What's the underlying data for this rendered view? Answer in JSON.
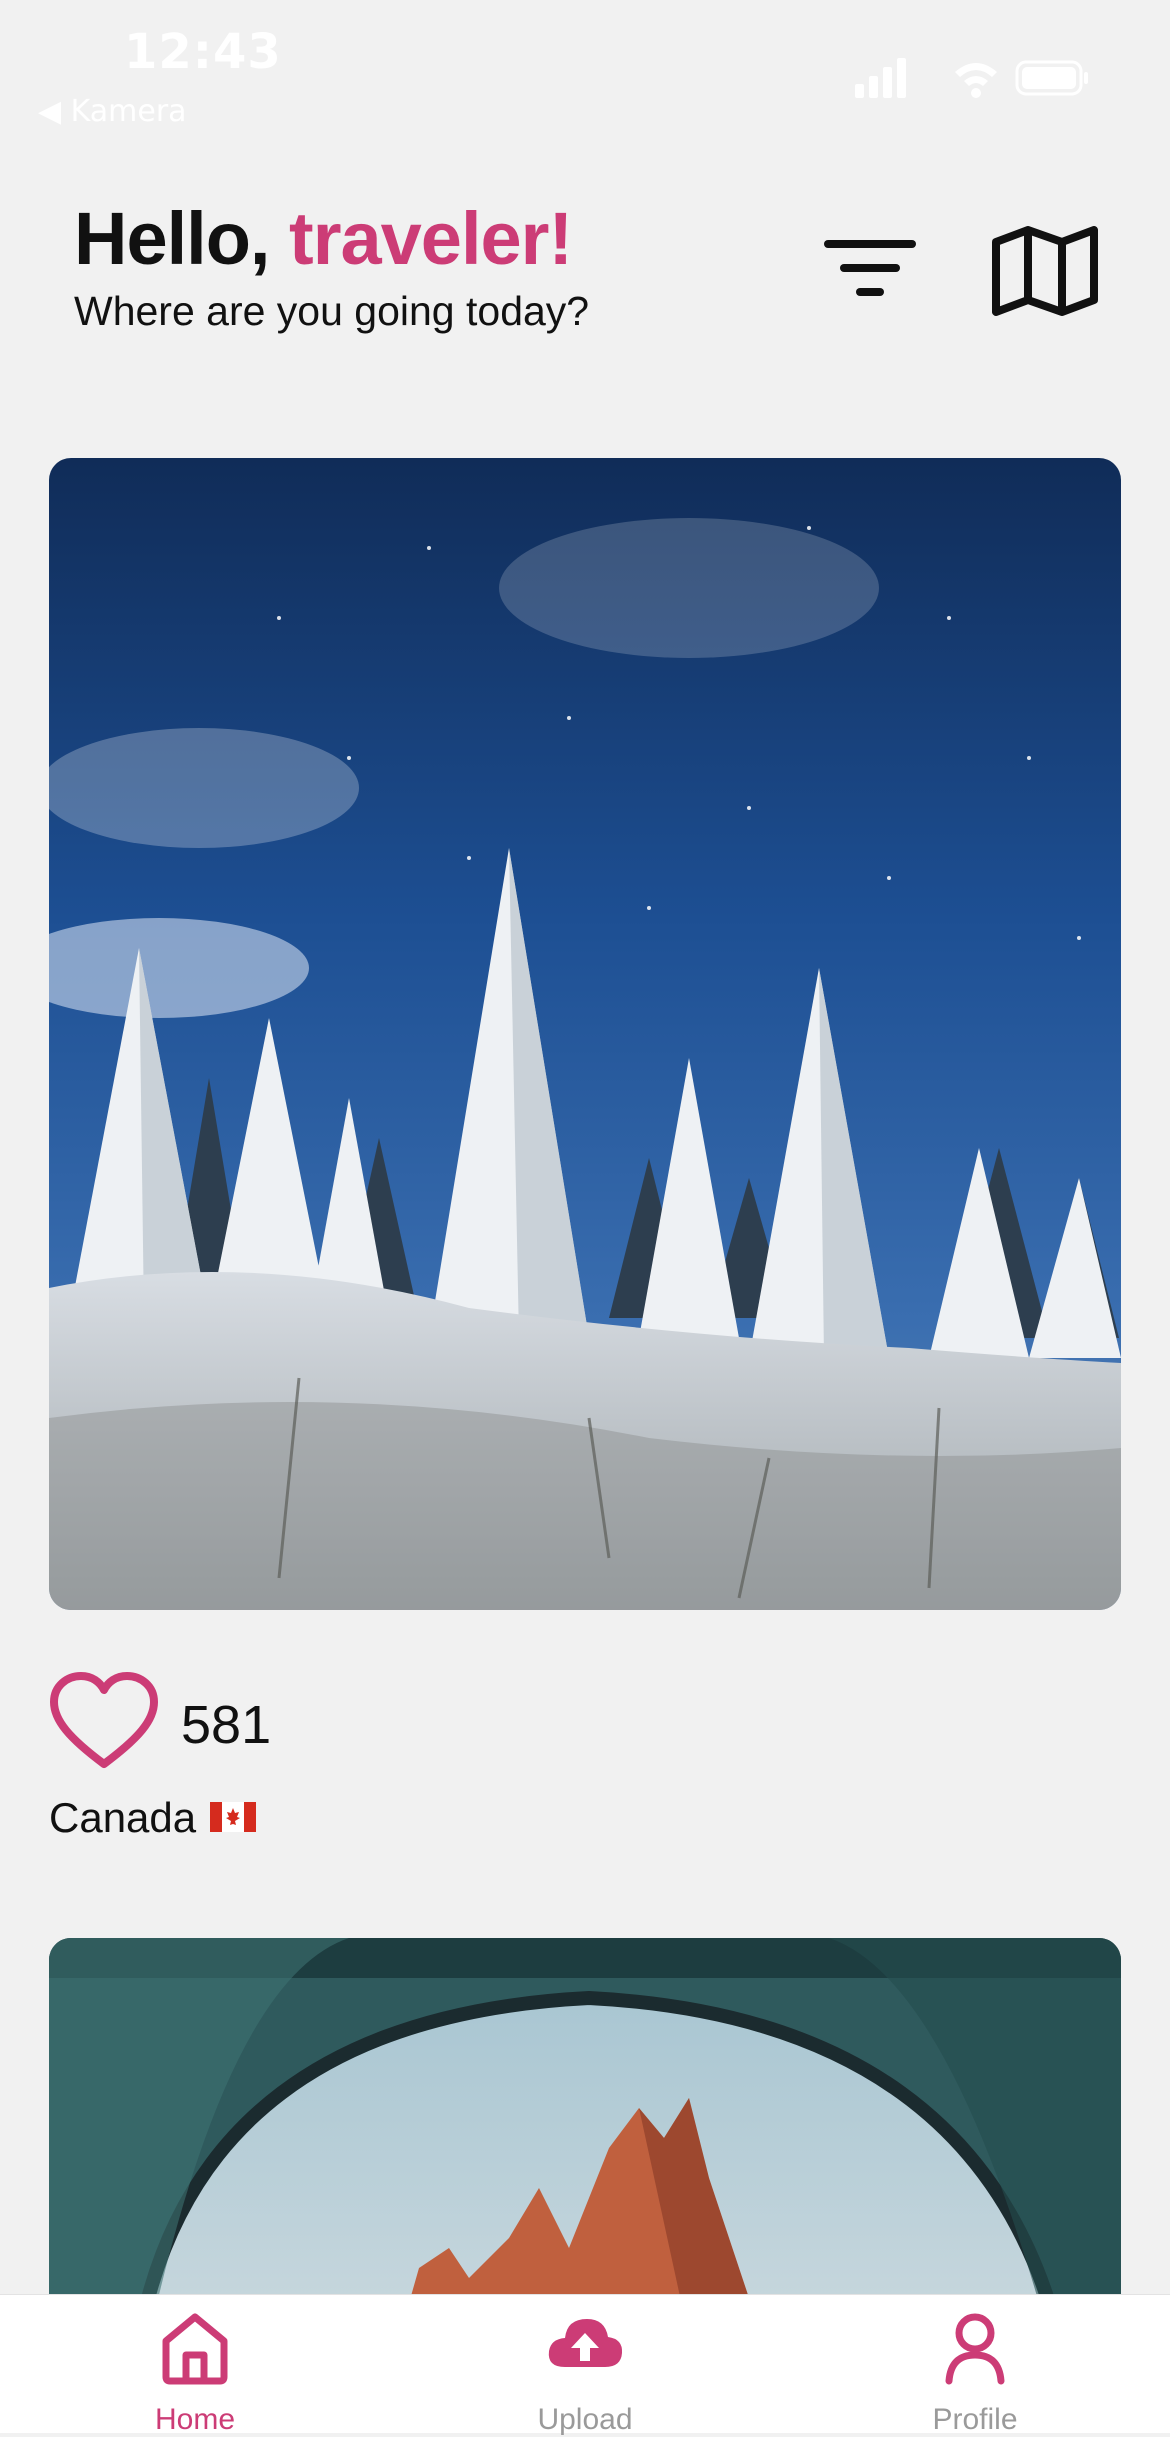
{
  "status_bar": {
    "time": "12:43",
    "back_label": "◀ Kamera"
  },
  "header": {
    "greeting_prefix": "Hello, ",
    "greeting_accent": "traveler!",
    "subtitle": "Where are you going today?",
    "accent_color": "#cc3c76"
  },
  "posts": [
    {
      "likes": "581",
      "location": "Canada",
      "flag_icon": "canada-flag-icon",
      "image": "snowy-forest-night-photo"
    },
    {
      "image": "tent-mountain-view-photo"
    }
  ],
  "nav": {
    "items": [
      {
        "label": "Home",
        "icon": "home-icon",
        "active": true
      },
      {
        "label": "Upload",
        "icon": "cloud-upload-icon",
        "active": false
      },
      {
        "label": "Profile",
        "icon": "user-icon",
        "active": false
      }
    ]
  }
}
